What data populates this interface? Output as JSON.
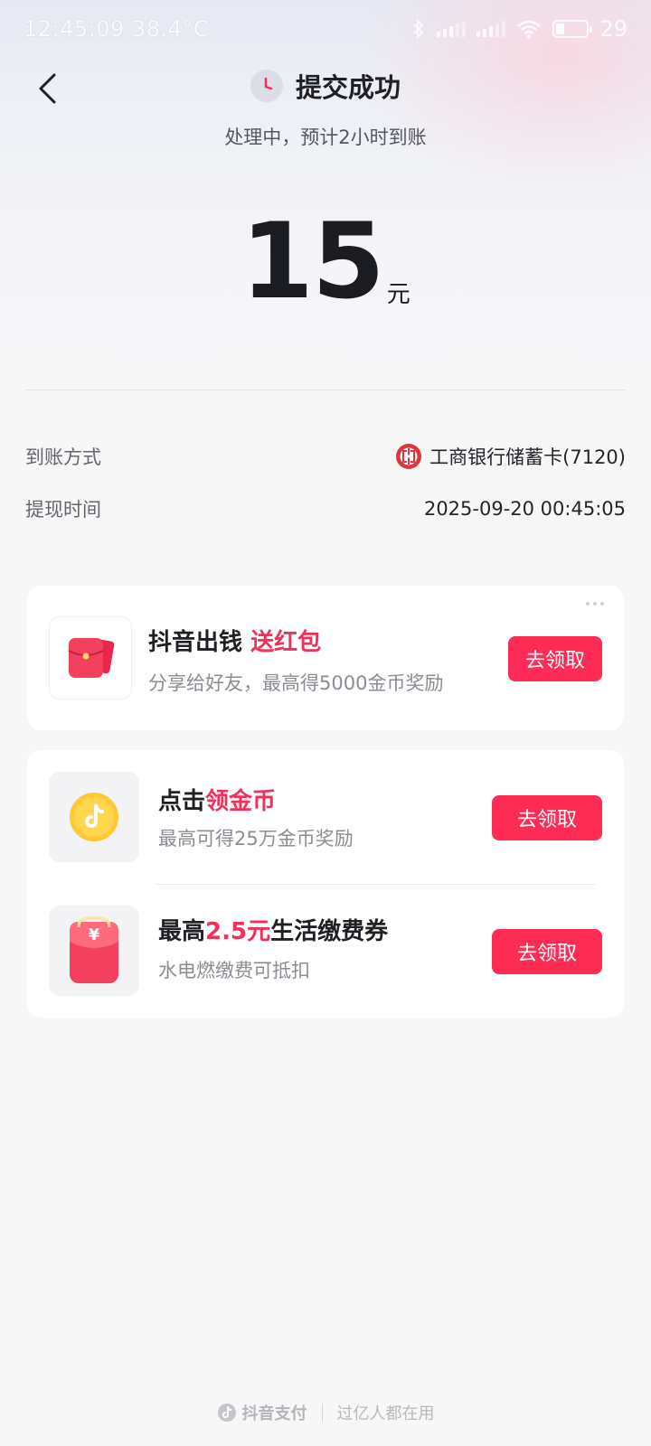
{
  "status_bar": {
    "time_temp": "12:45:09 38.4°C",
    "battery": "29",
    "battery_level": 0.29
  },
  "header": {
    "title": "提交成功",
    "subtitle": "处理中，预计2小时到账"
  },
  "amount": {
    "value": "15",
    "unit": "元"
  },
  "details": {
    "method_label": "到账方式",
    "method_value": "工商银行储蓄卡(7120)",
    "time_label": "提现时间",
    "time_value": "2025-09-20 00:45:05"
  },
  "promo1": {
    "title_plain": "抖音出钱",
    "title_highlight": "送红包",
    "desc": "分享给好友，最高得5000金币奖励",
    "button": "去领取"
  },
  "promo2": {
    "item1": {
      "title_plain": "点击",
      "title_highlight": "领金币",
      "desc": "最高可得25万金币奖励",
      "button": "去领取"
    },
    "item2": {
      "title_prefix": "最高",
      "title_highlight": "2.5元",
      "title_suffix": "生活缴费券",
      "desc": "水电燃缴费可抵扣",
      "button": "去领取"
    }
  },
  "footer": {
    "brand": "抖音支付",
    "slogan": "过亿人都在用"
  },
  "colors": {
    "accent": "#fe2c55",
    "highlight": "#f03059",
    "bank_red": "#e0343d"
  },
  "icons": [
    "back-arrow-icon",
    "clock-icon",
    "bluetooth-icon",
    "signal-icon",
    "wifi-icon",
    "battery-icon",
    "bank-icbc-icon",
    "red-envelope-icon",
    "douyin-coin-icon",
    "coupon-bag-icon",
    "douyin-logo-icon",
    "more-dots-icon"
  ]
}
